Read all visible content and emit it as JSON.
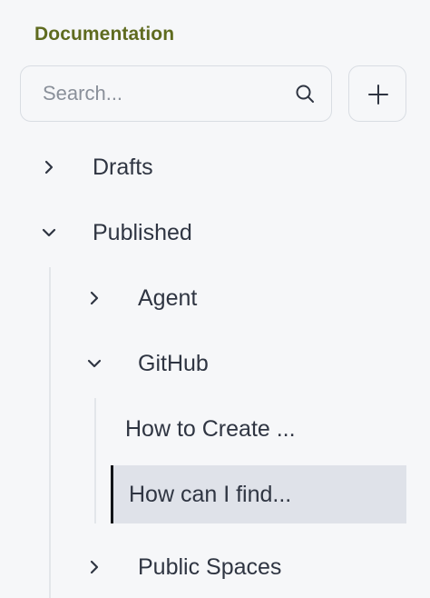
{
  "sidebar": {
    "title": "Documentation",
    "search": {
      "placeholder": "Search...",
      "value": ""
    },
    "add_button": {
      "icon": "plus-icon"
    },
    "tree": {
      "drafts": {
        "label": "Drafts",
        "expanded": false
      },
      "published": {
        "label": "Published",
        "expanded": true,
        "children": {
          "agent": {
            "label": "Agent",
            "expanded": false
          },
          "github": {
            "label": "GitHub",
            "expanded": true,
            "pages": [
              {
                "label": "How to Create ...",
                "selected": false
              },
              {
                "label": "How can I find...",
                "selected": true
              }
            ]
          },
          "public_spaces": {
            "label": "Public Spaces",
            "expanded": false
          }
        }
      }
    }
  },
  "colors": {
    "title": "#5f6b1f",
    "text": "#2f3542",
    "selected_bg": "#dfe2e9",
    "selected_border": "#111418",
    "background": "#f6f7f9"
  }
}
